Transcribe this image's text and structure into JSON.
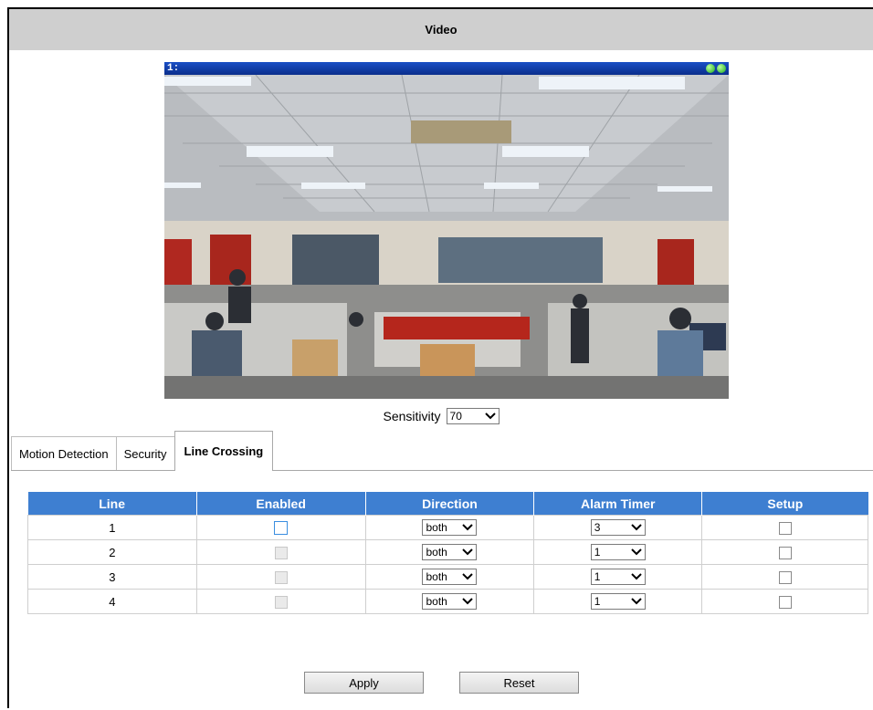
{
  "title": "Video",
  "video": {
    "channel_label": "1:"
  },
  "sensitivity": {
    "label": "Sensitivity",
    "value": "70"
  },
  "tabs": [
    {
      "label": "Motion Detection",
      "active": false
    },
    {
      "label": "Security",
      "active": false
    },
    {
      "label": "Line Crossing",
      "active": true
    }
  ],
  "table": {
    "headers": [
      "Line",
      "Enabled",
      "Direction",
      "Alarm Timer",
      "Setup"
    ],
    "rows": [
      {
        "line": "1",
        "enabled": false,
        "enabled_editable": true,
        "direction": "both",
        "alarm_timer": "3",
        "setup": false
      },
      {
        "line": "2",
        "enabled": false,
        "enabled_editable": false,
        "direction": "both",
        "alarm_timer": "1",
        "setup": false
      },
      {
        "line": "3",
        "enabled": false,
        "enabled_editable": false,
        "direction": "both",
        "alarm_timer": "1",
        "setup": false
      },
      {
        "line": "4",
        "enabled": false,
        "enabled_editable": false,
        "direction": "both",
        "alarm_timer": "1",
        "setup": false
      }
    ]
  },
  "buttons": {
    "apply": "Apply",
    "reset": "Reset"
  },
  "colors": {
    "header_bg": "#3e7fd1",
    "titlebar_bg": "#cfcfcf",
    "video_bar": "#0a2e8c"
  }
}
